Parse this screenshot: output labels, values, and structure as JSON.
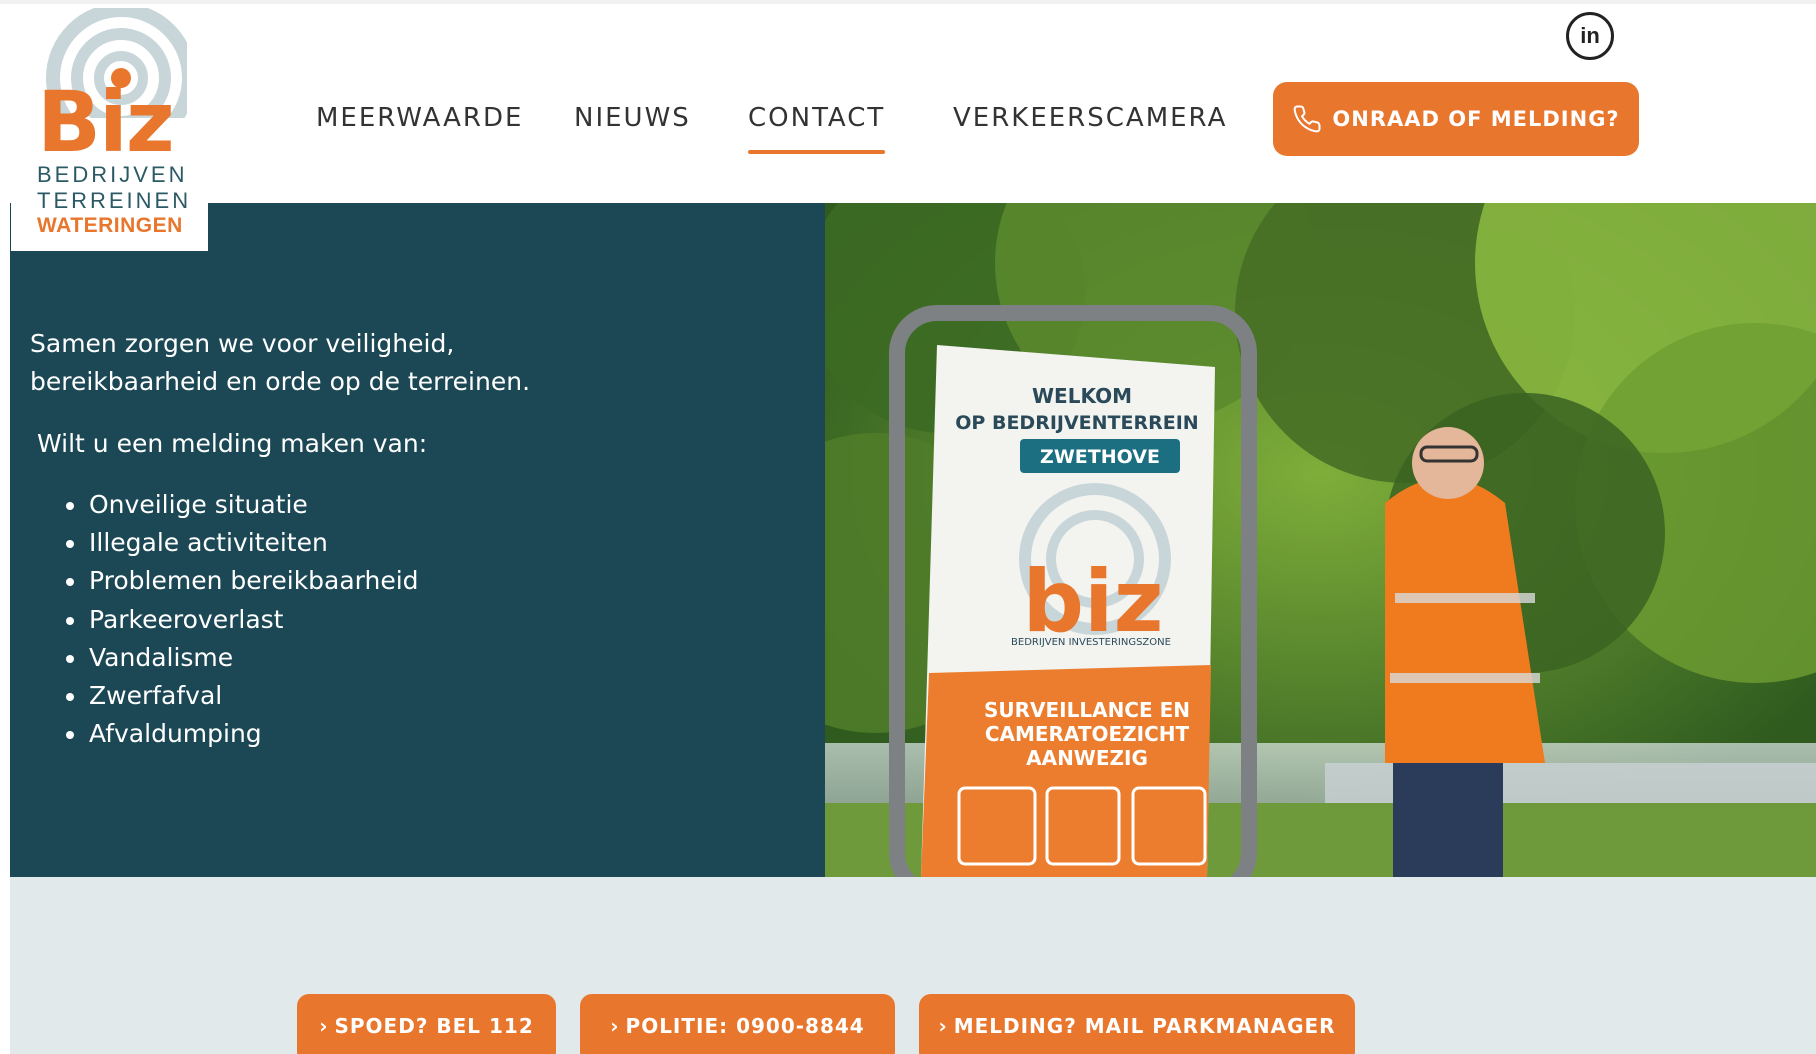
{
  "logo": {
    "brand": "Biz",
    "line1": "BEDRIJVEN",
    "line2": "TERREINEN",
    "line3": "WATERINGEN",
    "ring_color": "#c8d6da",
    "dot_color": "#e8762c"
  },
  "nav": {
    "items": [
      {
        "label": "MEERWAARDE"
      },
      {
        "label": "NIEUWS"
      },
      {
        "label": "CONTACT"
      },
      {
        "label": "VERKEERSCAMERA"
      }
    ],
    "active": "CONTACT",
    "cta_label": "ONRAAD OF MELDING?"
  },
  "social": {
    "linkedin_label": "in"
  },
  "hero": {
    "intro": "Samen zorgen we voor veiligheid, bereikbaarheid en orde op de terreinen.",
    "prompt": "Wilt u een melding maken van:",
    "list": [
      "Onveilige situatie",
      "Illegale activiteiten",
      "Problemen bereikbaarheid",
      "Parkeeroverlast",
      "Vandalisme",
      "Zwerfafval",
      "Afvaldumping"
    ],
    "photo": {
      "sign_line1": "WELKOM",
      "sign_line2": "OP BEDRIJVENTERREIN",
      "sign_banner": "ZWETHOVE",
      "sign_brand": "biz",
      "sign_sub": "BEDRIJVEN INVESTERINGSZONE",
      "sign_bottom1": "SURVEILLANCE EN",
      "sign_bottom2": "CAMERATOEZICHT",
      "sign_bottom3": "AANWEZIG"
    }
  },
  "actions": [
    {
      "label": "SPOED? BEL 112"
    },
    {
      "label": "POLITIE: 0900-8844"
    },
    {
      "label": "MELDING? MAIL PARKMANAGER"
    }
  ],
  "colors": {
    "accent": "#e8762c",
    "hero_bg": "#1c4856",
    "band_bg": "#e1e9ea"
  }
}
